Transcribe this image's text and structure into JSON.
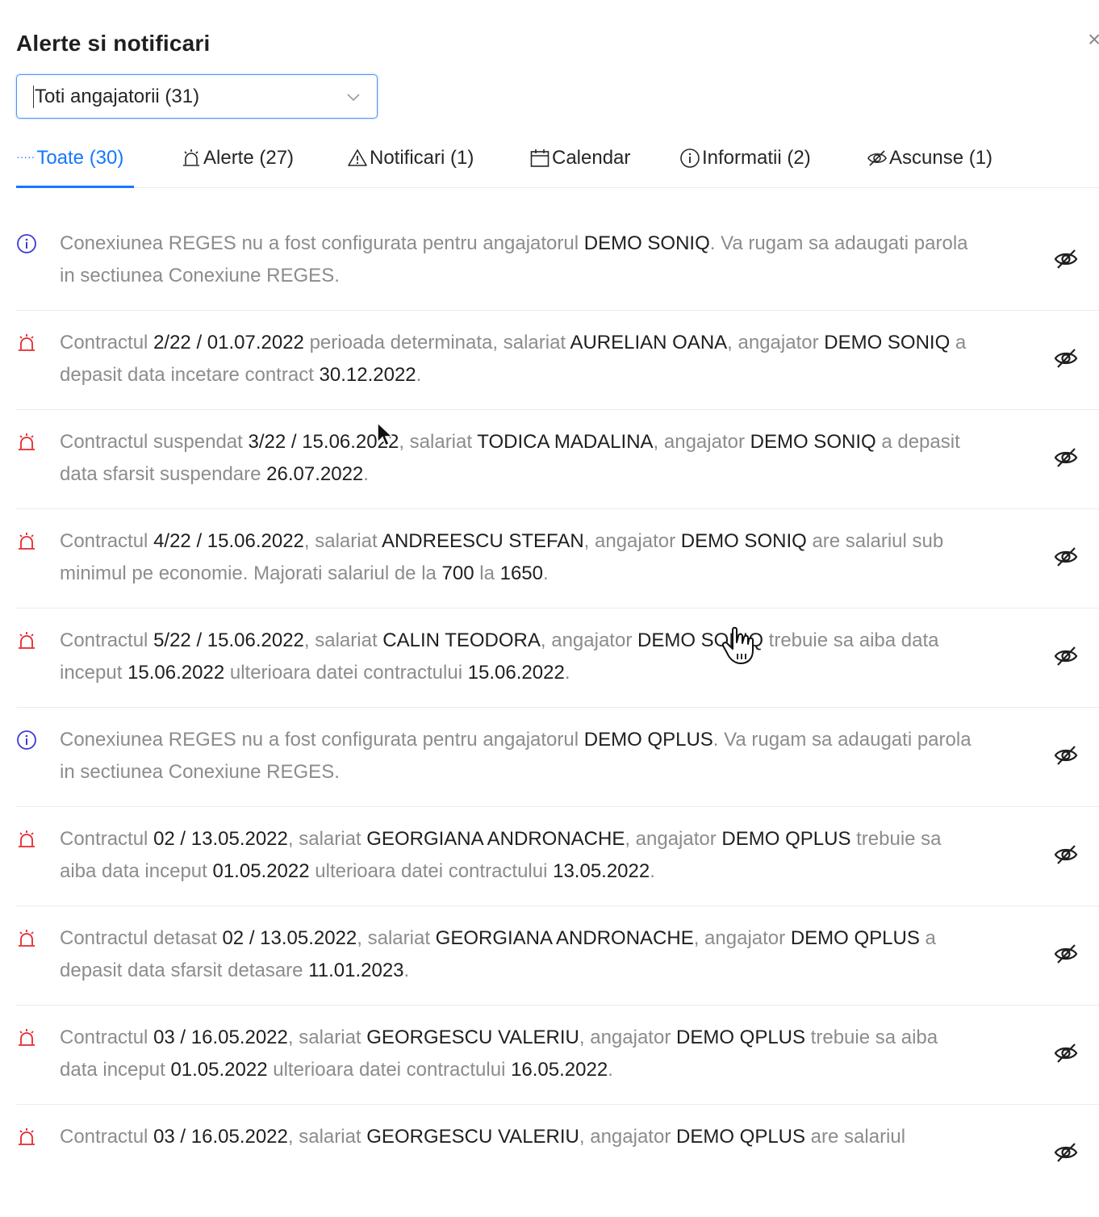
{
  "header": {
    "title": "Alerte si notificari",
    "close_glyph": "×"
  },
  "filter": {
    "selected": "Toti angajatorii (31)"
  },
  "tabs": [
    {
      "label": "Toate (30)",
      "icon": "dots-icon",
      "active": true
    },
    {
      "label": "Alerte (27)",
      "icon": "alarm-icon"
    },
    {
      "label": "Notificari (1)",
      "icon": "warning-icon"
    },
    {
      "label": "Calendar",
      "icon": "calendar-icon"
    },
    {
      "label": "Informatii (2)",
      "icon": "info-icon"
    },
    {
      "label": "Ascunse (1)",
      "icon": "eye-hidden-icon"
    }
  ],
  "colors": {
    "accent": "#1677ff",
    "alert": "#e5262f",
    "info": "#3a3ad8",
    "muted": "#8c8c8c",
    "strong": "#1f1f1f"
  },
  "items": [
    {
      "type": "info",
      "segments": [
        "Conexiunea REGES nu a fost configurata pentru angajatorul ",
        "DEMO SONIQ",
        ". Va rugam sa adaugati parola in sectiunea Conexiune REGES."
      ]
    },
    {
      "type": "alert",
      "segments": [
        "Contractul ",
        "2/22 / 01.07.2022",
        " perioada determinata, salariat ",
        "AURELIAN OANA",
        ", angajator ",
        "DEMO SONIQ",
        " a depasit data incetare contract ",
        "30.12.2022",
        "."
      ]
    },
    {
      "type": "alert",
      "segments": [
        "Contractul suspendat ",
        "3/22 / 15.06.2022",
        ", salariat ",
        "TODICA MADALINA",
        ", angajator ",
        "DEMO SONIQ",
        " a depasit data sfarsit suspendare ",
        "26.07.2022",
        "."
      ]
    },
    {
      "type": "alert",
      "segments": [
        "Contractul ",
        "4/22 / 15.06.2022",
        ", salariat ",
        "ANDREESCU STEFAN",
        ", angajator ",
        "DEMO SONIQ",
        " are salariul sub minimul pe economie. Majorati salariul de la ",
        "700",
        " la ",
        "1650",
        "."
      ]
    },
    {
      "type": "alert",
      "segments": [
        "Contractul ",
        "5/22 / 15.06.2022",
        ", salariat ",
        "CALIN TEODORA",
        ", angajator ",
        "DEMO SONIQ",
        " trebuie sa aiba data inceput ",
        "15.06.2022",
        " ulterioara datei contractului ",
        "15.06.2022",
        "."
      ]
    },
    {
      "type": "info",
      "segments": [
        "Conexiunea REGES nu a fost configurata pentru angajatorul ",
        "DEMO QPLUS",
        ". Va rugam sa adaugati parola in sectiunea Conexiune REGES."
      ]
    },
    {
      "type": "alert",
      "segments": [
        "Contractul ",
        "02 / 13.05.2022",
        ", salariat ",
        "GEORGIANA ANDRONACHE",
        ", angajator ",
        "DEMO QPLUS",
        " trebuie sa aiba data inceput ",
        "01.05.2022",
        " ulterioara datei contractului ",
        "13.05.2022",
        "."
      ]
    },
    {
      "type": "alert",
      "segments": [
        "Contractul detasat ",
        "02 / 13.05.2022",
        ", salariat ",
        "GEORGIANA ANDRONACHE",
        ", angajator ",
        "DEMO QPLUS",
        " a depasit data sfarsit detasare ",
        "11.01.2023",
        "."
      ]
    },
    {
      "type": "alert",
      "segments": [
        "Contractul ",
        "03 / 16.05.2022",
        ", salariat ",
        "GEORGESCU VALERIU",
        ", angajator ",
        "DEMO QPLUS",
        " trebuie sa aiba data inceput ",
        "01.05.2022",
        " ulterioara datei contractului ",
        "16.05.2022",
        "."
      ]
    },
    {
      "type": "alert",
      "segments": [
        "Contractul ",
        "03 / 16.05.2022",
        ", salariat ",
        "GEORGESCU VALERIU",
        ", angajator ",
        "DEMO QPLUS",
        " are salariul"
      ]
    }
  ]
}
